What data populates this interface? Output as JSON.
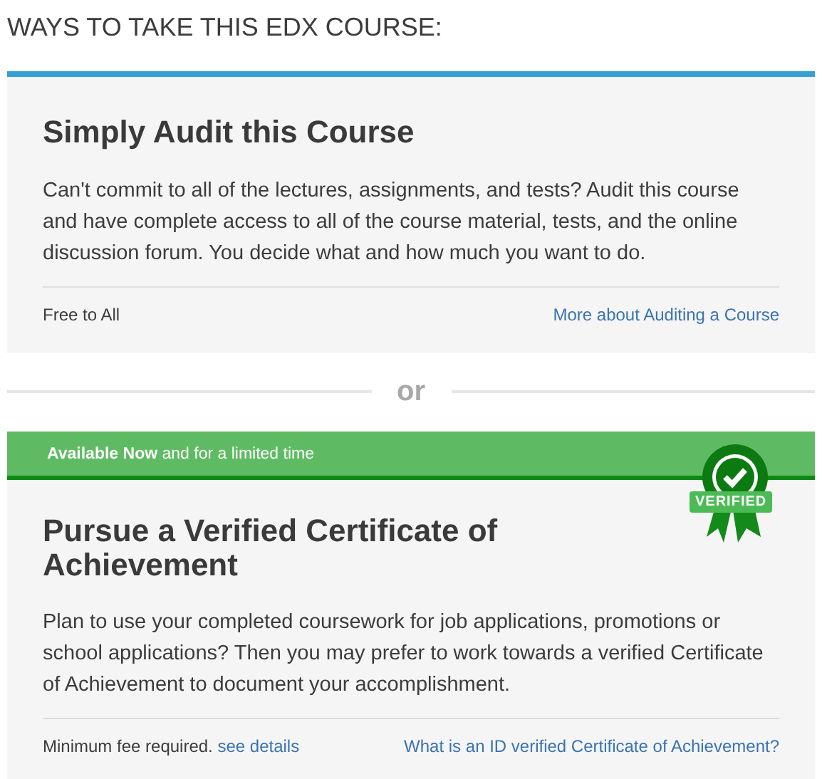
{
  "heading": "WAYS TO TAKE THIS EDX COURSE:",
  "audit": {
    "title": "Simply Audit this Course",
    "description": "Can't commit to all of the lectures, assignments, and tests? Audit this course and have complete access to all of the course material, tests, and the online discussion forum. You decide what and how much you want to do.",
    "price": "Free to All",
    "link": "More about Auditing a Course"
  },
  "separator": "or",
  "verified": {
    "banner": "**Available Now** and for a limited time",
    "badge": "VERIFIED",
    "title": "Pursue a Verified Certificate of Achievement",
    "description": "Plan to use your completed coursework for job applications, promotions or school applications? Then you may prefer to work towards a verified Certificate of Achievement to document your accomplishment.",
    "price": "Minimum fee required.",
    "price_link": "see details",
    "link": "What is an ID verified Certificate of Achievement?"
  }
}
